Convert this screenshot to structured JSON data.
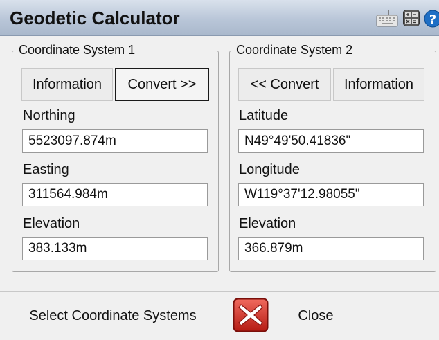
{
  "window": {
    "title": "Geodetic Calculator"
  },
  "toolbar": {
    "keyboard_icon": "keyboard-icon",
    "calculator_icon": "calculator-icon",
    "help_icon": "help-icon"
  },
  "system1": {
    "legend": "Coordinate System 1",
    "info_button": "Information",
    "convert_button": "Convert >>",
    "fields": [
      {
        "label": "Northing",
        "value": "5523097.874m"
      },
      {
        "label": "Easting",
        "value": "311564.984m"
      },
      {
        "label": "Elevation",
        "value": "383.133m"
      }
    ]
  },
  "system2": {
    "legend": "Coordinate System 2",
    "convert_button": "<< Convert",
    "info_button": "Information",
    "fields": [
      {
        "label": "Latitude",
        "value": "N49°49'50.41836\""
      },
      {
        "label": "Longitude",
        "value": "W119°37'12.98055\""
      },
      {
        "label": "Elevation",
        "value": "366.879m"
      }
    ]
  },
  "bottom": {
    "select_label": "Select Coordinate Systems",
    "close_label": "Close",
    "close_icon": "close-x-icon",
    "close_icon_color": "#d62b20"
  }
}
